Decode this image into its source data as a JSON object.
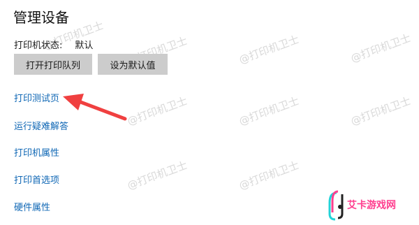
{
  "header": {
    "title": "管理设备"
  },
  "printer_status": {
    "label": "打印机状态:",
    "value": "默认"
  },
  "buttons": {
    "open_queue": "打开打印队列",
    "set_default": "设为默认值"
  },
  "links": {
    "test_page": "打印测试页",
    "troubleshoot": "运行疑难解答",
    "printer_properties": "打印机属性",
    "printing_preferences": "打印首选项",
    "hardware_properties": "硬件属性"
  },
  "watermarks": [
    "@打印机卫士",
    "@打印机卫士",
    "@打印机卫士",
    "@打印机卫士",
    "@打印机卫士",
    "@打印机卫士",
    "@打印机卫士",
    "@打印机卫士",
    "@打印机卫士"
  ],
  "brand_logo": {
    "text": "艾卡游戏网"
  },
  "colors": {
    "link": "#0f67b5",
    "button_bg": "#cccccc",
    "arrow": "#f04040",
    "brand": "#ff3f8f"
  }
}
